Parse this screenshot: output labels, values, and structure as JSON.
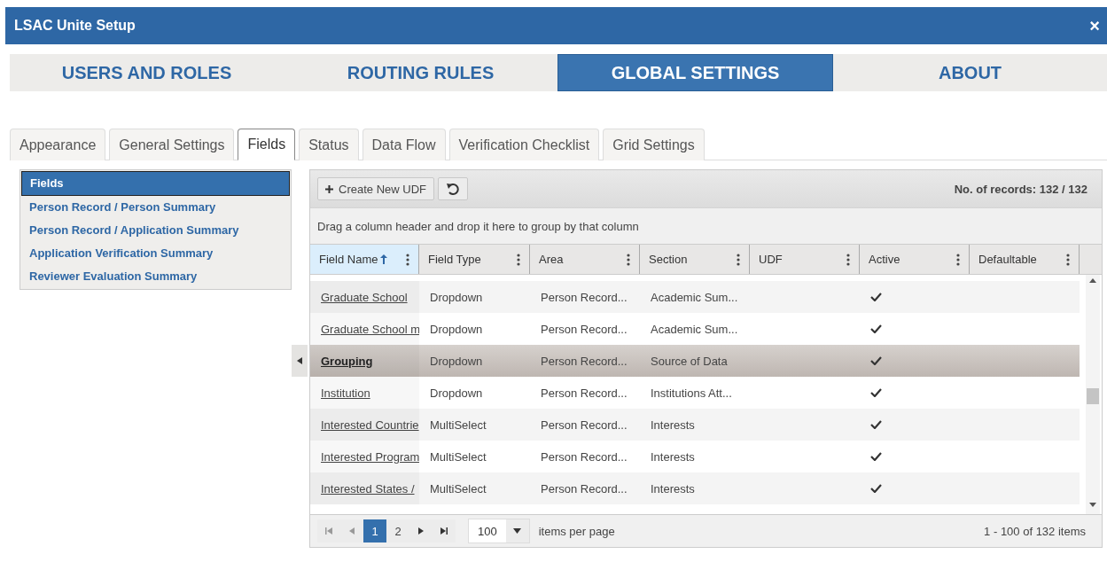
{
  "window": {
    "title": "LSAC Unite Setup",
    "close": "×"
  },
  "top_tabs": [
    {
      "label": "USERS AND ROLES",
      "selected": false
    },
    {
      "label": "ROUTING RULES",
      "selected": false
    },
    {
      "label": "GLOBAL SETTINGS",
      "selected": true
    },
    {
      "label": "ABOUT",
      "selected": false
    }
  ],
  "sub_tabs": [
    {
      "label": "Appearance",
      "selected": false
    },
    {
      "label": "General Settings",
      "selected": false
    },
    {
      "label": "Fields",
      "selected": true
    },
    {
      "label": "Status",
      "selected": false
    },
    {
      "label": "Data Flow",
      "selected": false
    },
    {
      "label": "Verification Checklist",
      "selected": false
    },
    {
      "label": "Grid Settings",
      "selected": false
    }
  ],
  "sidebar": {
    "items": [
      {
        "label": "Fields",
        "selected": true
      },
      {
        "label": "Person Record / Person Summary",
        "selected": false
      },
      {
        "label": "Person Record / Application Summary",
        "selected": false
      },
      {
        "label": "Application Verification Summary",
        "selected": false
      },
      {
        "label": "Reviewer Evaluation Summary",
        "selected": false
      }
    ]
  },
  "toolbar": {
    "create_button": "Create New UDF",
    "records": "No. of records: 132 / 132"
  },
  "group_hint": "Drag a column header and drop it here to group by that column",
  "table": {
    "columns": [
      {
        "label": "Field Name",
        "sorted": true
      },
      {
        "label": "Field Type",
        "sorted": false
      },
      {
        "label": "Area",
        "sorted": false
      },
      {
        "label": "Section",
        "sorted": false
      },
      {
        "label": "UDF",
        "sorted": false
      },
      {
        "label": "Active",
        "sorted": false
      },
      {
        "label": "Defaultable",
        "sorted": false
      }
    ],
    "rows": [
      {
        "field_name": "Graduate School",
        "field_type": "Dropdown",
        "area": "Person Record...",
        "section": "Academic Sum...",
        "active": true,
        "selected": false
      },
      {
        "field_name": "Graduate School m",
        "field_type": "Dropdown",
        "area": "Person Record...",
        "section": "Academic Sum...",
        "active": true,
        "selected": false
      },
      {
        "field_name": "Grouping",
        "field_type": "Dropdown",
        "area": "Person Record...",
        "section": "Source of Data",
        "active": true,
        "selected": true
      },
      {
        "field_name": "Institution",
        "field_type": "Dropdown",
        "area": "Person Record...",
        "section": "Institutions Att...",
        "active": true,
        "selected": false
      },
      {
        "field_name": "Interested Countrie",
        "field_type": "MultiSelect",
        "area": "Person Record...",
        "section": "Interests",
        "active": true,
        "selected": false
      },
      {
        "field_name": "Interested Program",
        "field_type": "MultiSelect",
        "area": "Person Record...",
        "section": "Interests",
        "active": true,
        "selected": false
      },
      {
        "field_name": "Interested States /",
        "field_type": "MultiSelect",
        "area": "Person Record...",
        "section": "Interests",
        "active": true,
        "selected": false
      }
    ]
  },
  "pager": {
    "pages": [
      {
        "label": "1",
        "selected": true
      },
      {
        "label": "2",
        "selected": false
      }
    ],
    "page_size": "100",
    "per_page_label": "items per page",
    "range": "1 - 100 of 132 items"
  }
}
